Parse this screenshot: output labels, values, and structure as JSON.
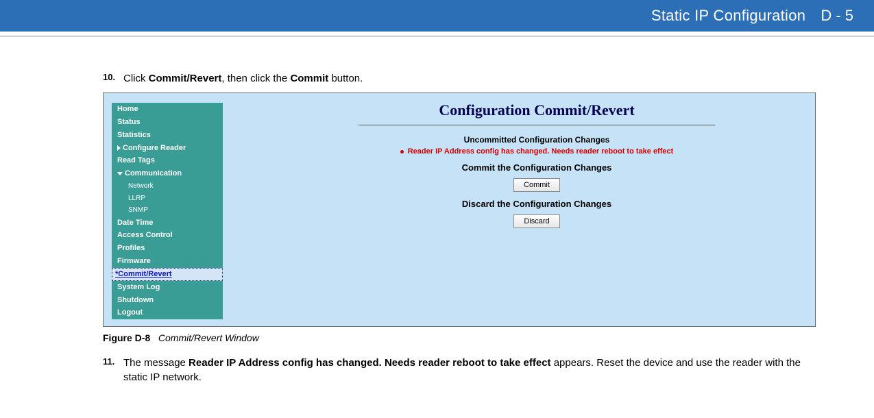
{
  "header": {
    "title": "Static IP Configuration",
    "page_ref": "D - 5"
  },
  "step10": {
    "num": "10.",
    "pre": "Click ",
    "bold1": "Commit/Revert",
    "mid": ", then click the ",
    "bold2": "Commit",
    "post": " button."
  },
  "sidebar": {
    "home": "Home",
    "status": "Status",
    "statistics": "Statistics",
    "configure_reader": "Configure Reader",
    "read_tags": "Read Tags",
    "communication": "Communication",
    "network": "Network",
    "llrp": "LLRP",
    "snmp": "SNMP",
    "date_time": "Date Time",
    "access_control": "Access Control",
    "profiles": "Profiles",
    "firmware": "Firmware",
    "commit_revert": "*Commit/Revert",
    "system_log": "System Log",
    "shutdown": "Shutdown",
    "logout": "Logout"
  },
  "panel": {
    "title": "Configuration Commit/Revert",
    "uncommitted_header": "Uncommitted Configuration Changes",
    "change_msg": "Reader IP Address config has changed. Needs reader reboot to take effect",
    "commit_header": "Commit the Configuration Changes",
    "commit_btn": "Commit",
    "discard_header": "Discard the Configuration Changes",
    "discard_btn": "Discard"
  },
  "figure": {
    "label": "Figure D-8",
    "title": "Commit/Revert Window"
  },
  "step11": {
    "num": "11.",
    "pre": "The message ",
    "bold": "Reader IP Address config has changed. Needs reader reboot to take effect",
    "post": " appears. Reset the device and use the reader with the static IP network."
  }
}
